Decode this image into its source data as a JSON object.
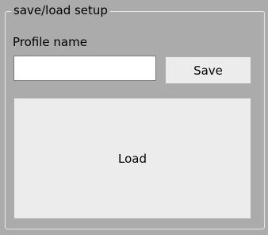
{
  "group": {
    "title": "save/load setup"
  },
  "profile": {
    "label": "Profile name",
    "value": "",
    "placeholder": ""
  },
  "buttons": {
    "save_label": "Save",
    "load_label": "Load"
  }
}
